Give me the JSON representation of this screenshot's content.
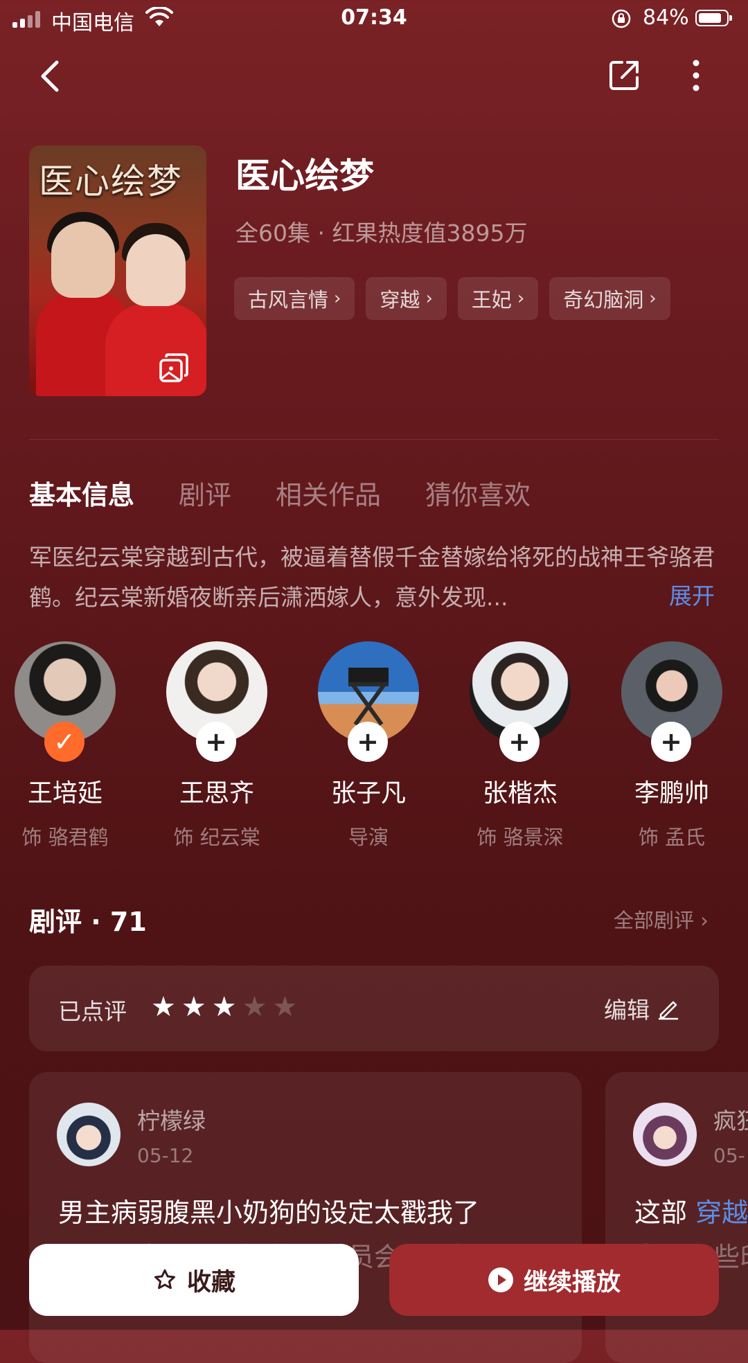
{
  "status_bar": {
    "carrier": "中国电信",
    "time": "07:34",
    "battery_percent": "84%",
    "battery_level": 0.84
  },
  "nav": {
    "back_icon": "chevron-left-icon",
    "share_icon": "share-icon",
    "more_icon": "more-vertical-icon"
  },
  "show": {
    "poster_title": "医心绘梦",
    "title": "医心绘梦",
    "meta": "全60集 · 红果热度值3895万",
    "tags": [
      "古风言情",
      "穿越",
      "王妃",
      "奇幻脑洞"
    ]
  },
  "tabs": [
    "基本信息",
    "剧评",
    "相关作品",
    "猜你喜欢"
  ],
  "description": {
    "text": "军医纪云棠穿越到古代，被逼着替假千金替嫁给将死的战神王爷骆君鹤。纪云棠新婚夜断亲后潇洒嫁人，意外发现...",
    "expand_label": "展开"
  },
  "cast": [
    {
      "name": "王培延",
      "role": "饰 骆君鹤",
      "followed": true
    },
    {
      "name": "王思齐",
      "role": "饰 纪云棠",
      "followed": false
    },
    {
      "name": "张子凡",
      "role": "导演",
      "followed": false
    },
    {
      "name": "张楷杰",
      "role": "饰 骆景深",
      "followed": false
    },
    {
      "name": "李鹏帅",
      "role": "饰 孟氏",
      "followed": false
    }
  ],
  "reviews": {
    "heading": "剧评 · 71",
    "all_label": "全部剧评 ›",
    "rated_label": "已点评",
    "rating": 3,
    "rating_max": 5,
    "edit_label": "编辑",
    "cards": [
      {
        "user": "柠檬绿",
        "date": "05-12",
        "text": "男主病弱腹黑小奶狗的设定太戳我了",
        "text_line2": "【…】女配很有智慧，全员会觉得挺……看"
      },
      {
        "user": "疯狂",
        "date": "05-",
        "text_prefix": "这部 ",
        "text_highlight": "穿越",
        "text_line2": "女主有些印女"
      }
    ]
  },
  "bottom_bar": {
    "collect_label": "收藏",
    "play_label": "继续播放"
  },
  "colors": {
    "accent_blue": "#5b8ee8",
    "follow_orange": "#ff6b2b",
    "play_button": "#a12b2e"
  }
}
